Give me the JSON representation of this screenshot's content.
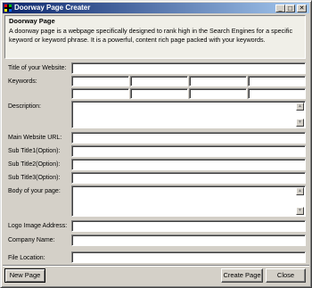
{
  "window": {
    "title": "Doorway Page Creater",
    "minimize_glyph": "_",
    "maximize_glyph": "□",
    "close_glyph": "✕"
  },
  "header": {
    "title": "Doorway Page",
    "description": "A doorway page is a webpage specifically designed to rank high in the Search Engines for a specific keyword or keyword phrase. It is a powerful, content rich page packed with your keywords."
  },
  "form": {
    "title_label": "Title of your Website:",
    "keywords_label": "Keywords:",
    "description_label": "Description:",
    "main_url_label": "Main Website URL:",
    "subtitle1_label": "Sub Title1(Option):",
    "subtitle2_label": "Sub Title2(Option):",
    "subtitle3_label": "Sub Title3(Option):",
    "body_label": "Body of your page:",
    "logo_label": "Logo Image Address:",
    "company_label": "Company Name:",
    "file_location_label": "File Location:"
  },
  "buttons": {
    "new_page": "New Page",
    "create_page": "Create Page",
    "close": "Close"
  },
  "icons": {
    "scroll_up": "▲",
    "scroll_down": "▼"
  }
}
